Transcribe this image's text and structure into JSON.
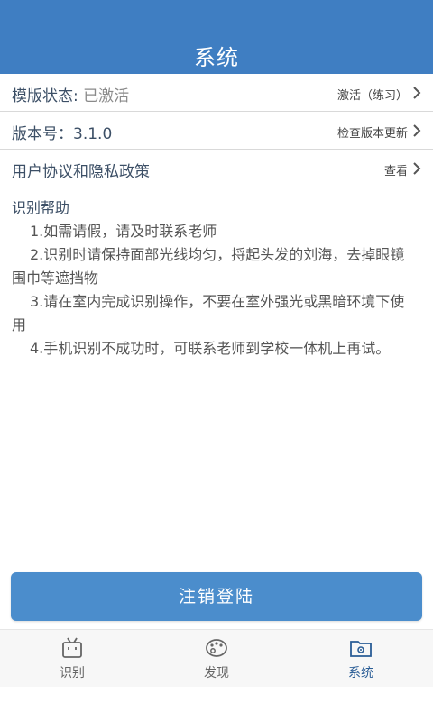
{
  "header": {
    "title": "系统"
  },
  "rows": [
    {
      "label": "模版状态:",
      "value": "已激活",
      "action": "激活（练习）"
    },
    {
      "label": "版本号：3.1.0",
      "value": "",
      "action": "检查版本更新"
    },
    {
      "label": "用户协议和隐私政策",
      "value": "",
      "action": "查看"
    }
  ],
  "help": {
    "title": "识别帮助",
    "items": [
      "1.如需请假，请及时联系老师",
      "2.识别时请保持面部光线均匀，捋起头发的刘海，去掉眼镜围巾等遮挡物",
      "3.请在室内完成识别操作，不要在室外强光或黑暗环境下使用",
      "4.手机识别不成功时，可联系老师到学校一体机上再试。"
    ]
  },
  "logout_label": "注销登陆",
  "tabs": [
    {
      "label": "识别",
      "icon": "tv-icon"
    },
    {
      "label": "发现",
      "icon": "palette-icon"
    },
    {
      "label": "系统",
      "icon": "settings-folder-icon"
    }
  ],
  "colors": {
    "header": "#3f7ec2",
    "button": "#4b8dcc",
    "active_tab": "#2a5d96"
  }
}
